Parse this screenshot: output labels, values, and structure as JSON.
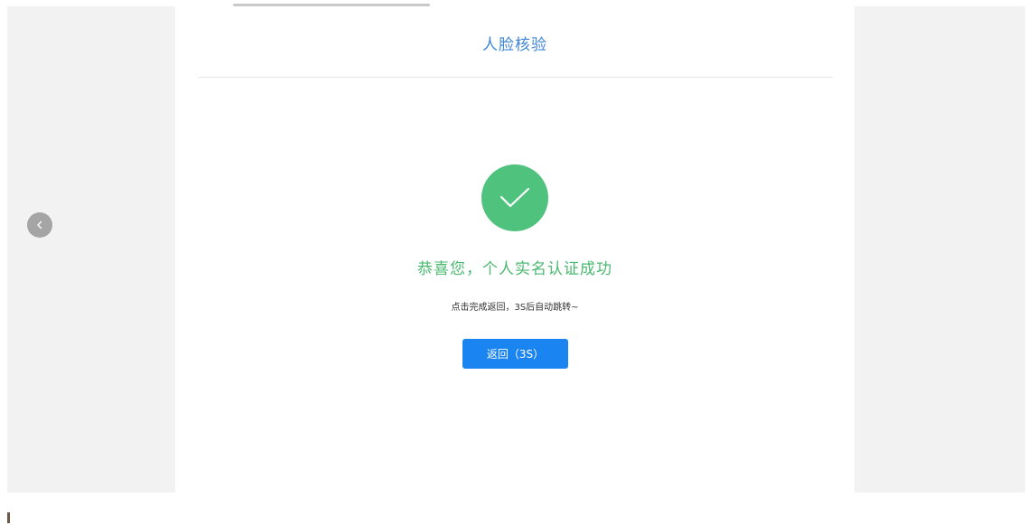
{
  "page": {
    "title": "人脸核验"
  },
  "result": {
    "icon": "check-circle-icon",
    "success_message": "恭喜您，个人实名认证成功",
    "hint": "点击完成返回，3S后自动跳转~",
    "return_button_label": "返回（3S）"
  },
  "navigation": {
    "back_icon": "chevron-left-icon"
  },
  "colors": {
    "title": "#3f86d8",
    "success": "#4fc37e",
    "button": "#1a84f0",
    "side_panel": "#f2f2f2"
  }
}
